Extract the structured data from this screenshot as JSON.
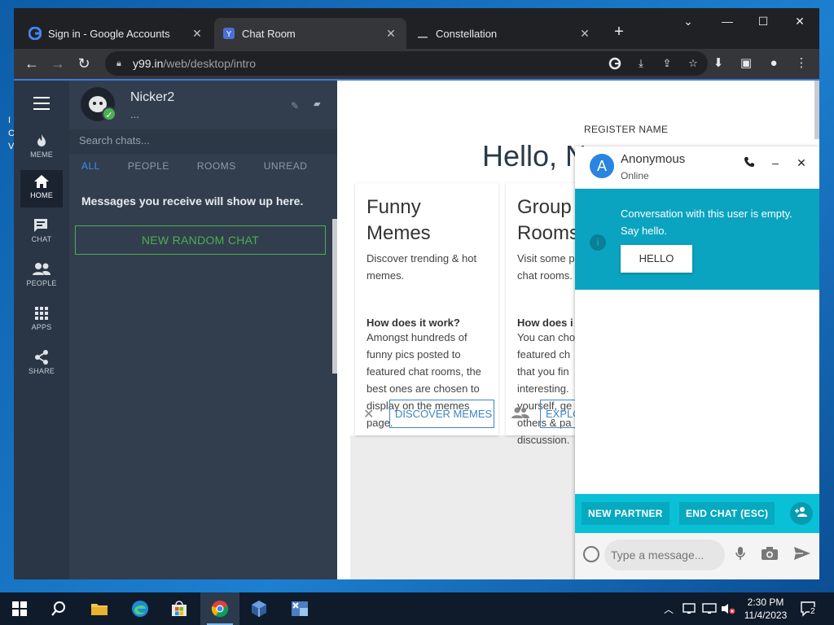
{
  "browser": {
    "tabs": [
      {
        "title": "Sign in - Google Accounts",
        "active": false
      },
      {
        "title": "Chat Room",
        "active": true
      },
      {
        "title": "Constellation",
        "active": false
      }
    ],
    "url_host": "y99.in",
    "url_path": "/web/desktop/intro"
  },
  "rail": {
    "items": [
      {
        "label": "MEME",
        "icon": "flame-icon"
      },
      {
        "label": "HOME",
        "icon": "home-icon"
      },
      {
        "label": "CHAT",
        "icon": "chat-icon"
      },
      {
        "label": "PEOPLE",
        "icon": "people-icon"
      },
      {
        "label": "APPS",
        "icon": "apps-icon"
      },
      {
        "label": "SHARE",
        "icon": "share-icon"
      }
    ]
  },
  "profile": {
    "name": "Nicker2",
    "status": "..."
  },
  "chats": {
    "search_placeholder": "Search chats...",
    "filters": [
      "ALL",
      "PEOPLE",
      "ROOMS",
      "UNREAD"
    ],
    "empty_message": "Messages you receive will show up here.",
    "new_random_label": "NEW RANDOM CHAT"
  },
  "main": {
    "register_name": "REGISTER NAME",
    "greeting": "Hello, N",
    "cards": [
      {
        "title_line1": "Funny",
        "title_line2": "Memes",
        "desc": "Discover trending & hot memes.",
        "question": "How does it work?",
        "answer": "Amongst hundreds of funny pics posted to featured chat rooms, the best ones are chosen to display on the memes page.",
        "button": "DISCOVER MEMES"
      },
      {
        "title_line1": "Group",
        "title_line2": "Rooms",
        "desc": "Visit some p chat rooms.",
        "question": "How does i",
        "answer": "You can cho featured ch that you fin interesting. yourself, ge others & pa discussion.",
        "button": "EXPLO"
      }
    ]
  },
  "popup": {
    "avatar_letter": "A",
    "name": "Anonymous",
    "status": "Online",
    "banner_text": "Conversation with this user is empty. Say hello.",
    "hello_button": "HELLO",
    "new_partner": "NEW PARTNER",
    "end_chat": "END CHAT (ESC)",
    "input_placeholder": "Type a message..."
  },
  "taskbar": {
    "time": "2:30 PM",
    "date": "11/4/2023",
    "notification_count": "2"
  },
  "colors": {
    "rail_bg": "#2a3646",
    "chat_col_bg": "#323e4e",
    "accent_green": "#4caf50",
    "teal": "#0aa4c0",
    "link_blue": "#3d85c6"
  }
}
